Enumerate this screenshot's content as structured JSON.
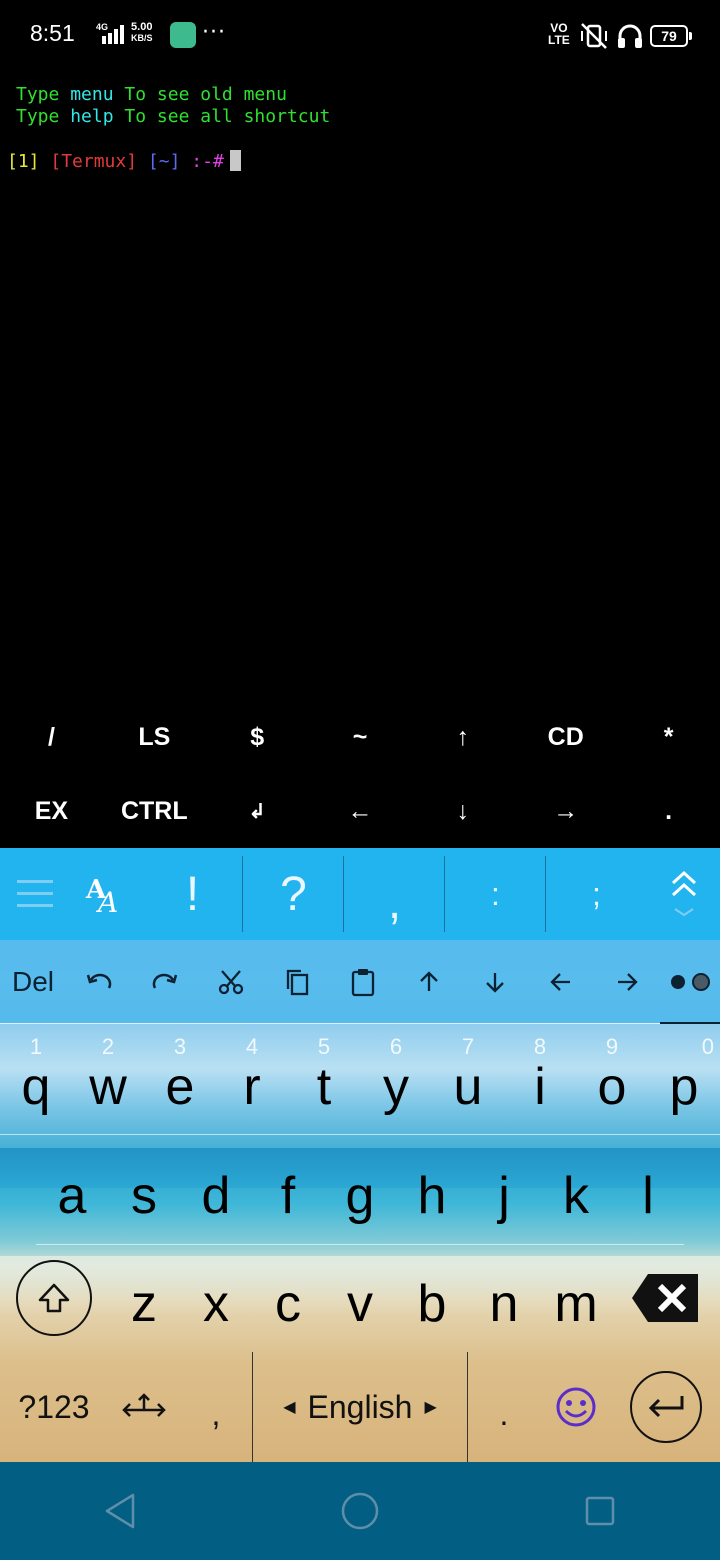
{
  "status_bar": {
    "time": "8:51",
    "network_type": "4G",
    "speed_value": "5.00",
    "speed_unit": "KB/S",
    "more": "···",
    "volte_top": "VO",
    "volte_bottom": "LTE",
    "battery": "79"
  },
  "terminal": {
    "line1": {
      "w1": "Type ",
      "w2": "menu",
      "w3": " To see old menu"
    },
    "line2": {
      "w1": "Type ",
      "w2": "help",
      "w3": " To see all shortcut"
    },
    "prompt": {
      "num": "[1]",
      "app": "[Termux]",
      "dir": "[~]",
      "sym": ":-#"
    }
  },
  "extra_keys": {
    "row1": [
      "/",
      "LS",
      "$",
      "~",
      "↑",
      "CD",
      "*"
    ],
    "row2": [
      "EX",
      "CTRL",
      "↲",
      "←",
      "↓",
      "→",
      "."
    ]
  },
  "keyboard": {
    "suggestion_punct": [
      "!",
      "?",
      ",",
      ":",
      ";"
    ],
    "action_bar": {
      "del": "Del"
    },
    "row1": [
      {
        "k": "q",
        "h": "1"
      },
      {
        "k": "w",
        "h": "2"
      },
      {
        "k": "e",
        "h": "3"
      },
      {
        "k": "r",
        "h": "4"
      },
      {
        "k": "t",
        "h": "5"
      },
      {
        "k": "y",
        "h": "6"
      },
      {
        "k": "u",
        "h": "7"
      },
      {
        "k": "i",
        "h": "8"
      },
      {
        "k": "o",
        "h": "9"
      },
      {
        "k": "p",
        "h": "0"
      }
    ],
    "row2": [
      "a",
      "s",
      "d",
      "f",
      "g",
      "h",
      "j",
      "k",
      "l"
    ],
    "row3": [
      "z",
      "x",
      "c",
      "v",
      "b",
      "n",
      "m"
    ],
    "bottom": {
      "symbols": "?123",
      "comma": ",",
      "language": "English",
      "period": "."
    }
  },
  "colors": {
    "terminal_green": "#30e030",
    "terminal_cyan": "#35e6e6",
    "keyboard_topbar": "#22b4ef",
    "navbar": "#035e84"
  }
}
